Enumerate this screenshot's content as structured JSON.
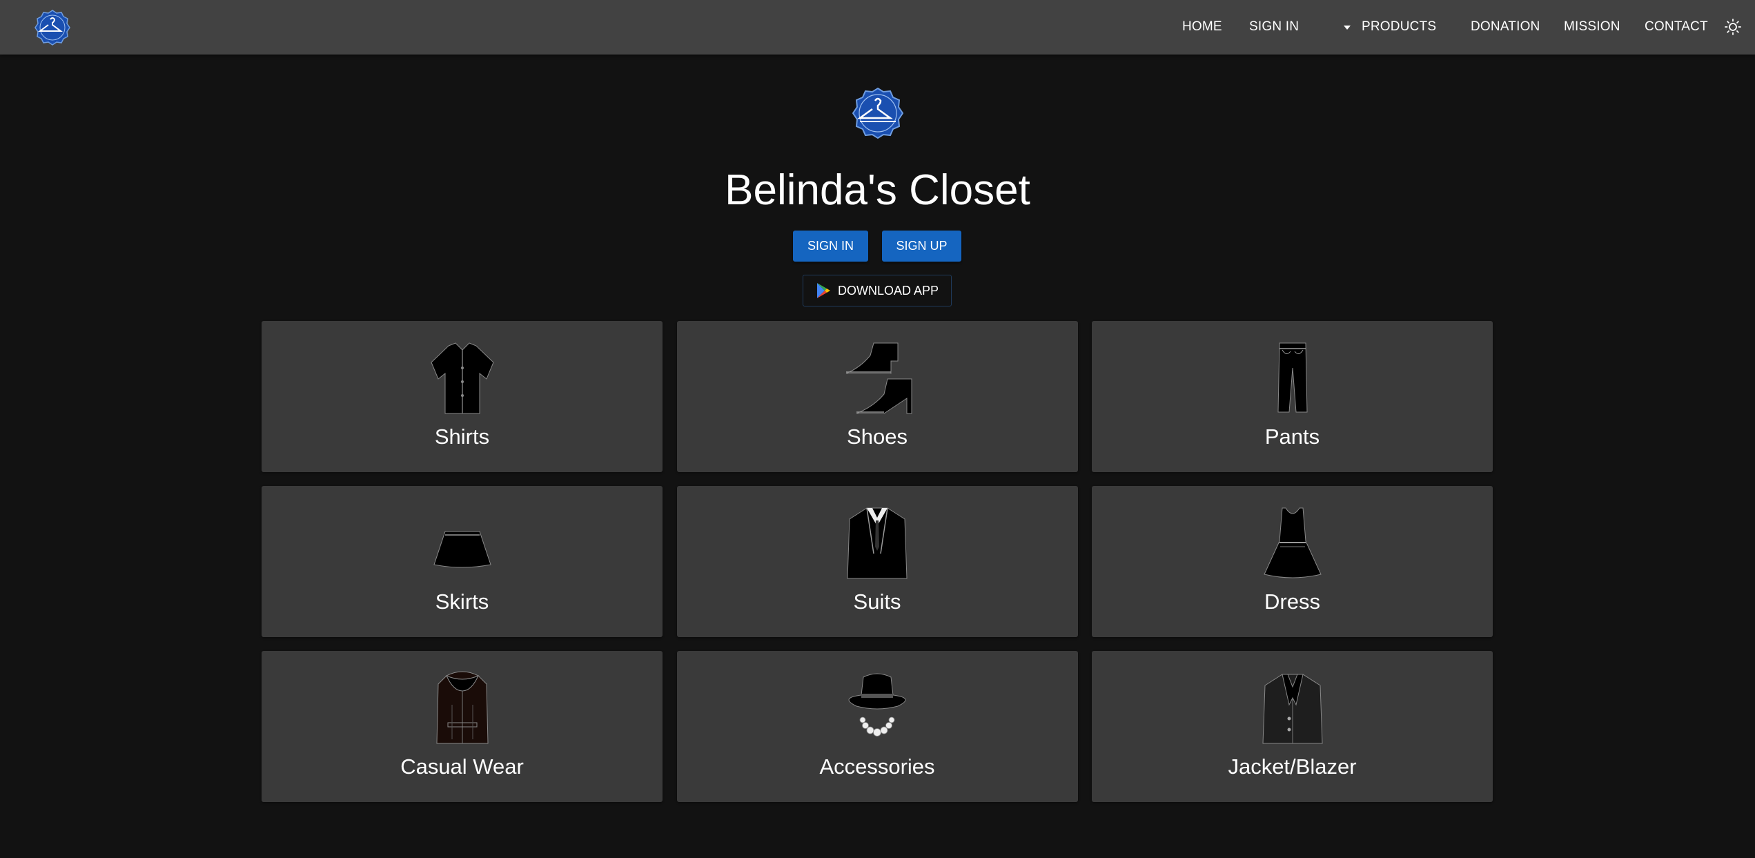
{
  "nav": {
    "home": "HOME",
    "sign_in": "SIGN IN",
    "products": "PRODUCTS",
    "donation": "DONATION",
    "mission": "MISSION",
    "contact": "CONTACT",
    "logo_icon": "hanger-logo-icon",
    "theme_icon": "sun-icon"
  },
  "hero": {
    "title": "Belinda's Closet",
    "sign_in_label": "SIGN IN",
    "sign_up_label": "SIGN UP",
    "download_label": "DOWNLOAD APP",
    "download_icon": "google-play-icon"
  },
  "categories": [
    {
      "label": "Shirts",
      "icon": "shirt-icon"
    },
    {
      "label": "Shoes",
      "icon": "shoes-icon"
    },
    {
      "label": "Pants",
      "icon": "pants-icon"
    },
    {
      "label": "Skirts",
      "icon": "skirt-icon"
    },
    {
      "label": "Suits",
      "icon": "suit-icon"
    },
    {
      "label": "Dress",
      "icon": "dress-icon"
    },
    {
      "label": "Casual Wear",
      "icon": "jacket-icon"
    },
    {
      "label": "Accessories",
      "icon": "hat-necklace-icon"
    },
    {
      "label": "Jacket/Blazer",
      "icon": "blazer-icon"
    }
  ],
  "colors": {
    "background": "#121212",
    "nav_bar": "#424242",
    "card": "#3a3a3a",
    "primary": "#1565c0",
    "logo_blue": "#1a4fb0"
  }
}
